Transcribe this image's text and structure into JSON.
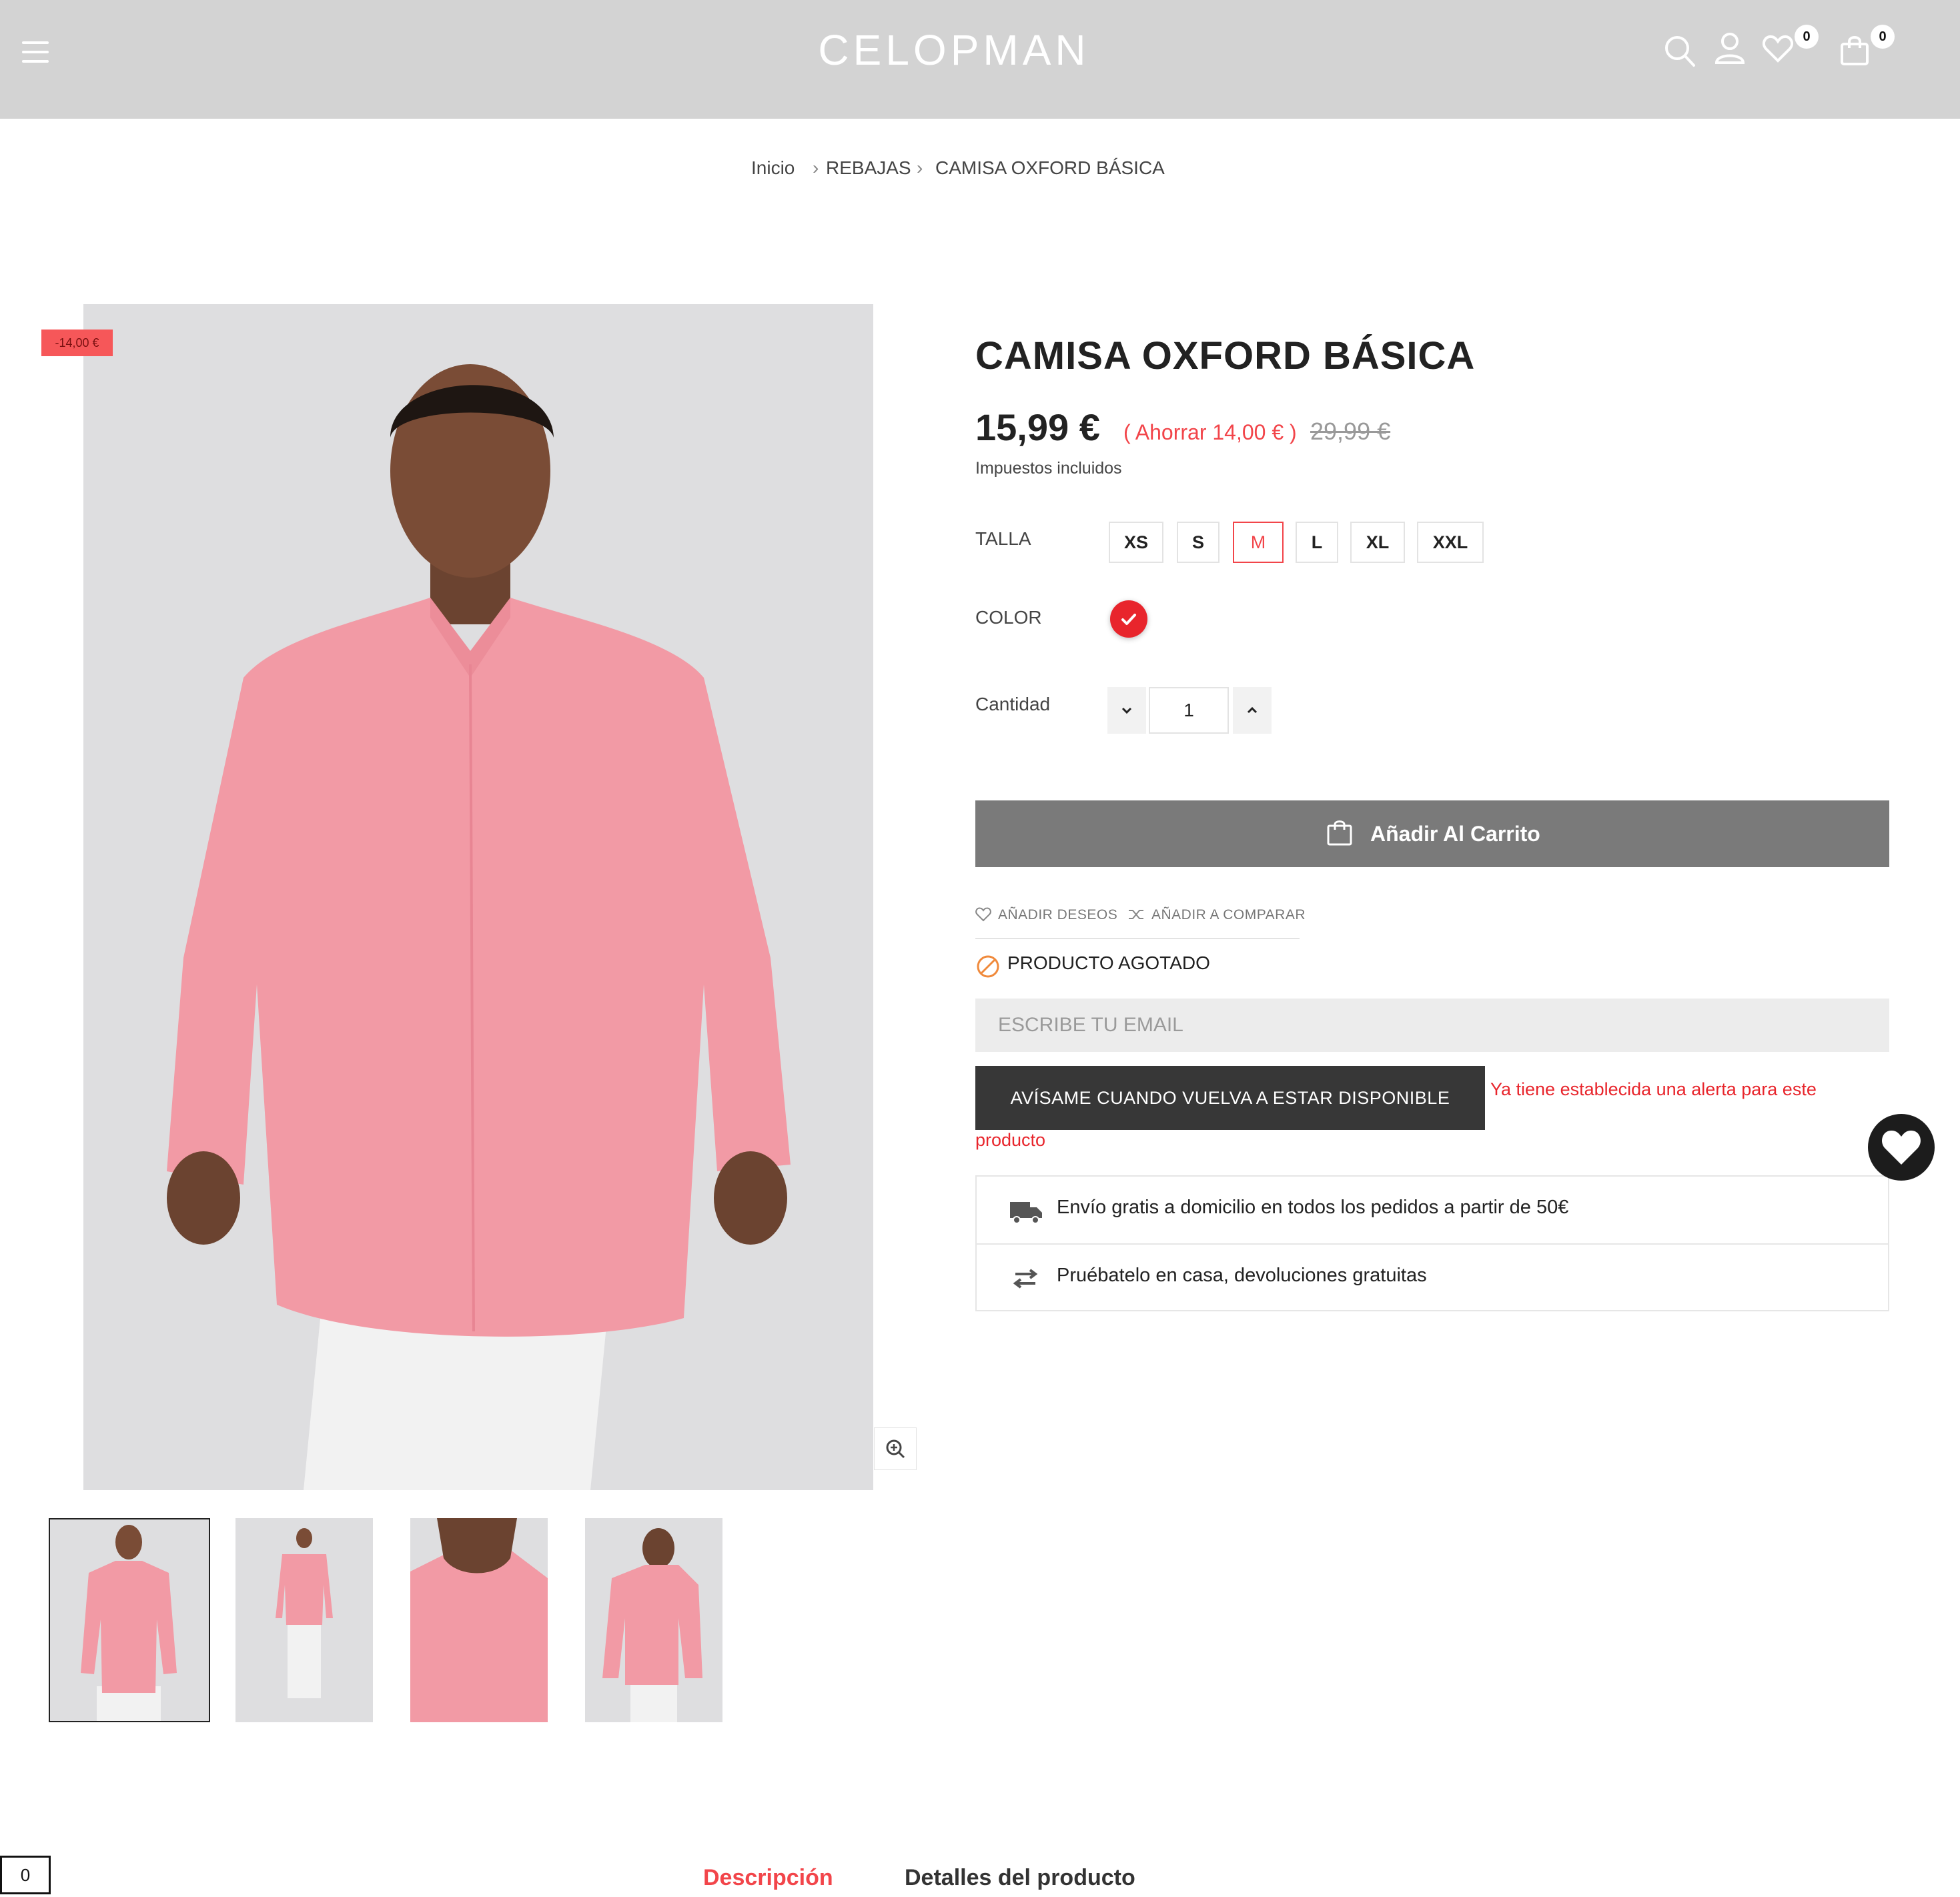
{
  "header": {
    "logo": "CELOPMAN",
    "wishlist_count": "0",
    "cart_count": "0"
  },
  "breadcrumb": {
    "home": "Inicio",
    "category": "REBAJAS",
    "current": "CAMISA OXFORD BÁSICA"
  },
  "product": {
    "discount_badge": "-14,00 €",
    "title": "CAMISA OXFORD BÁSICA",
    "price": "15,99 €",
    "save": "( Ahorrar 14,00 € )",
    "old_price": "29,99 €",
    "tax_note": "Impuestos incluidos",
    "size_label": "TALLA",
    "sizes": [
      "XS",
      "S",
      "M",
      "L",
      "XL",
      "XXL"
    ],
    "selected_size": "M",
    "color_label": "COLOR",
    "color_value": "#e8252c",
    "quantity_label": "Cantidad",
    "quantity": "1",
    "add_to_cart": "Añadir Al Carrito",
    "wishlist_link": "AÑADIR DESEOS",
    "compare_link": "AÑADIR A COMPARAR",
    "stock_status": "PRODUCTO AGOTADO",
    "email_placeholder": "ESCRIBE TU EMAIL",
    "notify_button": "AVÍSAME CUANDO VUELVA A ESTAR DISPONIBLE",
    "alert_message_line1": "Ya tiene establecida una alerta para este",
    "alert_message_line2": "producto"
  },
  "benefits": [
    {
      "icon": "truck-icon",
      "text": "Envío gratis a domicilio en todos los pedidos a partir de 50€"
    },
    {
      "icon": "exchange-arrows-icon",
      "text": "Pruébatelo en casa, devoluciones gratuitas"
    }
  ],
  "tabs": {
    "description": "Descripción",
    "details": "Detalles del producto"
  },
  "counter": "0",
  "colors": {
    "accent_red": "#f2454a",
    "header_bg": "#d3d3d3",
    "shirt_pink": "#f29aa5"
  }
}
